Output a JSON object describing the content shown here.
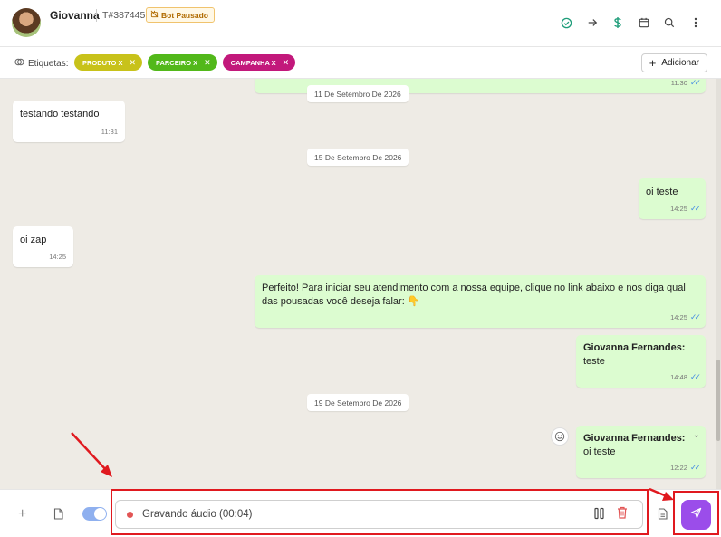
{
  "header": {
    "contact_name": "Giovanna",
    "ticket": "T#387445",
    "bot_badge": "Bot Pausado",
    "icons": [
      "check-circle-icon",
      "arrow-right-icon",
      "dollar-icon",
      "calendar-icon",
      "search-icon",
      "more-vertical-icon"
    ]
  },
  "tagsbar": {
    "label": "Etiquetas:",
    "tags": [
      {
        "label": "PRODUTO X",
        "color": "#c8c21a"
      },
      {
        "label": "PARCEIRO X",
        "color": "#52b81a"
      },
      {
        "label": "CAMPANHA X",
        "color": "#c2187b"
      }
    ],
    "add_label": "Adicionar"
  },
  "chat": {
    "top_time": "11:30",
    "dates": [
      "11 De Setembro De 2026",
      "15 De Setembro De 2026",
      "19 De Setembro De 2026"
    ],
    "messages": [
      {
        "direction": "in",
        "text": "testando testando",
        "time": "11:31"
      },
      {
        "direction": "out",
        "text": "oi teste",
        "time": "14:25"
      },
      {
        "direction": "in",
        "text": "oi zap",
        "time": "14:25"
      },
      {
        "direction": "out",
        "text": "Perfeito! Para iniciar seu atendimento com a nossa equipe, clique no link abaixo e nos diga qual das pousadas você deseja falar: 👇",
        "time": "14:25"
      },
      {
        "direction": "out",
        "sender": "Giovanna Fernandes:",
        "text": "teste",
        "time": "14:48"
      },
      {
        "direction": "out",
        "sender": "Giovanna Fernandes:",
        "text": "oi teste",
        "time": "12:22"
      }
    ]
  },
  "composer": {
    "recording_text": "Gravando áudio (00:04)"
  },
  "colors": {
    "accent": "#9b4dea",
    "outgoing_bubble": "#dcfcd0",
    "chat_background": "#eeebe5",
    "annotation_red": "#e0191f"
  }
}
